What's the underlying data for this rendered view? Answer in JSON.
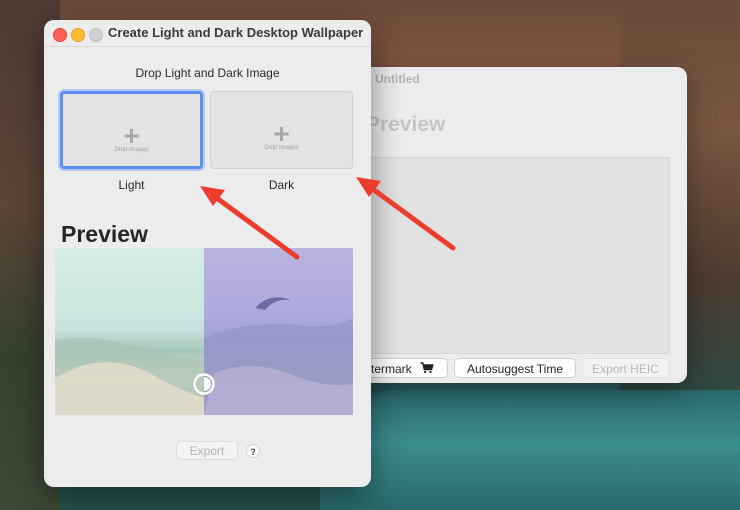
{
  "back_window": {
    "title": "Untitled",
    "preview_title": "Preview",
    "buttons": {
      "watermark": "termark",
      "autosuggest": "Autosuggest Time",
      "export_heic": "Export HEIC"
    },
    "icons": {
      "watermark_icon": "cart-icon"
    }
  },
  "front_window": {
    "title": "Create Light and Dark Desktop Wallpaper",
    "drop_heading": "Drop Light and Dark Image",
    "wells": [
      {
        "plus": "+",
        "hint": "Drop Images",
        "label": "Light"
      },
      {
        "plus": "+",
        "hint": "Drop Images",
        "label": "Dark"
      }
    ],
    "preview_title": "Preview",
    "export_label": "Export",
    "help_label": "?"
  },
  "colors": {
    "annotation_arrow": "#ec3d2c",
    "focus_ring": "#5e8ff0",
    "traffic_red": "#fe5f57",
    "traffic_yellow": "#febc2e"
  }
}
